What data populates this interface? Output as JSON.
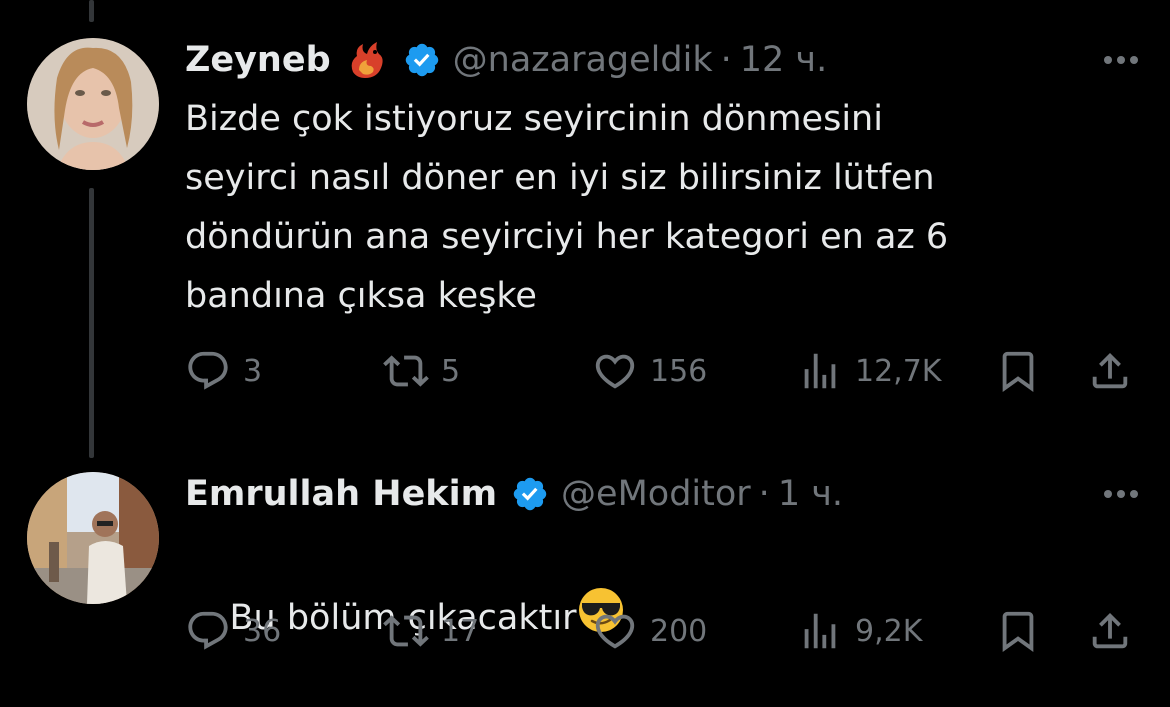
{
  "tweets": [
    {
      "name": "Zeyneb",
      "handle": "@nazarageldik",
      "separator": "·",
      "time": "12 ч.",
      "text": "Bizde çok istiyoruz seyircinin dönmesini\nseyirci nasıl döner en iyi siz bilirsiniz lütfen\ndöndürün ana seyirciyi her kategori en az 6\nbandına çıksa keşke",
      "flair_icon": "fire-dragon-emoji-icon",
      "stats": {
        "replies": "3",
        "retweets": "5",
        "likes": "156",
        "views": "12,7K"
      }
    },
    {
      "name": "Emrullah Hekim",
      "handle": "@eModitor",
      "separator": "·",
      "time": "1 ч.",
      "text": "Bu bölüm çıkacaktır",
      "trailing_emoji": "sunglasses-emoji-icon",
      "stats": {
        "replies": "36",
        "retweets": "17",
        "likes": "200",
        "views": "9,2K"
      }
    }
  ],
  "colors": {
    "background": "#000000",
    "text": "#e7e9ea",
    "secondary": "#71767b",
    "verified": "#1d9bf0",
    "thread_line": "#333639"
  }
}
